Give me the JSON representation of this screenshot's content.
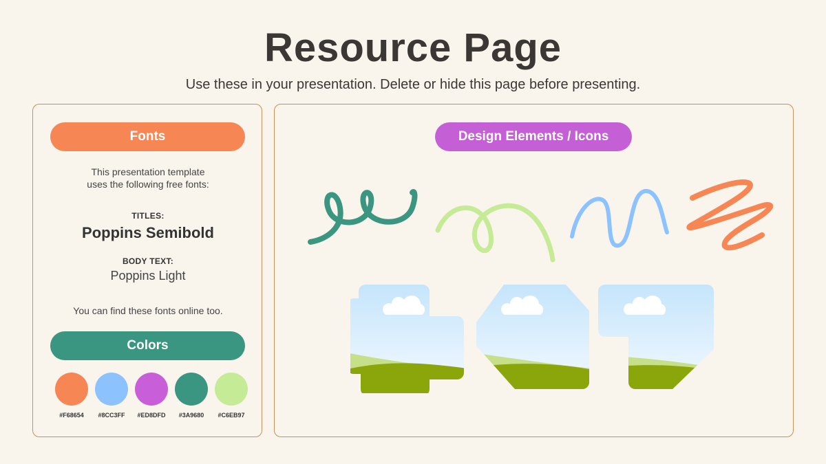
{
  "header": {
    "title": "Resource Page",
    "subtitle": "Use these in your presentation. Delete or hide this page before presenting."
  },
  "fonts_panel": {
    "heading": "Fonts",
    "intro_line1": "This presentation template",
    "intro_line2": "uses the following free fonts:",
    "titles_label": "TITLES:",
    "titles_font": "Poppins Semibold",
    "body_label": "BODY TEXT:",
    "body_font": "Poppins Light",
    "online_note": "You can find these fonts online too."
  },
  "colors_panel": {
    "heading": "Colors",
    "swatches": [
      {
        "hex": "#F68654"
      },
      {
        "hex": "#8CC3FF"
      },
      {
        "hex": "#ED8DFD"
      },
      {
        "hex": "#3A9680"
      },
      {
        "hex": "#C6EB97"
      }
    ]
  },
  "design_panel": {
    "heading": "Design Elements / Icons",
    "squiggles": [
      {
        "icon": "green-loop-squiggle-icon",
        "color": "#3A9680"
      },
      {
        "icon": "lightgreen-loop-squiggle-icon",
        "color": "#C6EB97"
      },
      {
        "icon": "blue-wave-squiggle-icon",
        "color": "#8CC3FF"
      },
      {
        "icon": "orange-zigzag-squiggle-icon",
        "color": "#F68654"
      }
    ],
    "landscape_frames": [
      {
        "icon": "landscape-frame-notched-icon"
      },
      {
        "icon": "landscape-frame-octagon-icon"
      },
      {
        "icon": "landscape-frame-stepped-icon"
      }
    ]
  }
}
